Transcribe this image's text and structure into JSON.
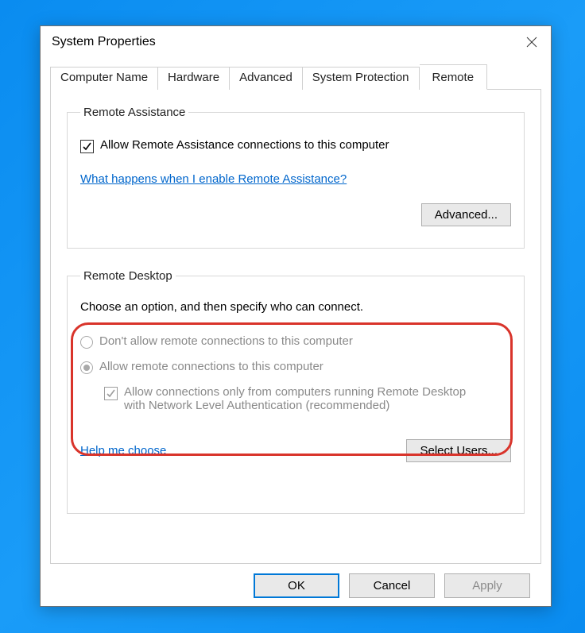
{
  "window": {
    "title": "System Properties"
  },
  "tabs": {
    "items": [
      {
        "label": "Computer Name"
      },
      {
        "label": "Hardware"
      },
      {
        "label": "Advanced"
      },
      {
        "label": "System Protection"
      },
      {
        "label": "Remote"
      }
    ],
    "active_index": 4
  },
  "remote_assistance": {
    "legend": "Remote Assistance",
    "allow_checkbox_label": "Allow Remote Assistance connections to this computer",
    "allow_checked": true,
    "help_link": "What happens when I enable Remote Assistance?",
    "advanced_button": "Advanced..."
  },
  "remote_desktop": {
    "legend": "Remote Desktop",
    "instruction": "Choose an option, and then specify who can connect.",
    "option_disallow": "Don't allow remote connections to this computer",
    "option_allow": "Allow remote connections to this computer",
    "selected_option": "allow",
    "nla_label": "Allow connections only from computers running Remote Desktop with Network Level Authentication (recommended)",
    "nla_checked": true,
    "help_link": "Help me choose",
    "select_users_button": "Select Users..."
  },
  "footer": {
    "ok": "OK",
    "cancel": "Cancel",
    "apply": "Apply"
  }
}
